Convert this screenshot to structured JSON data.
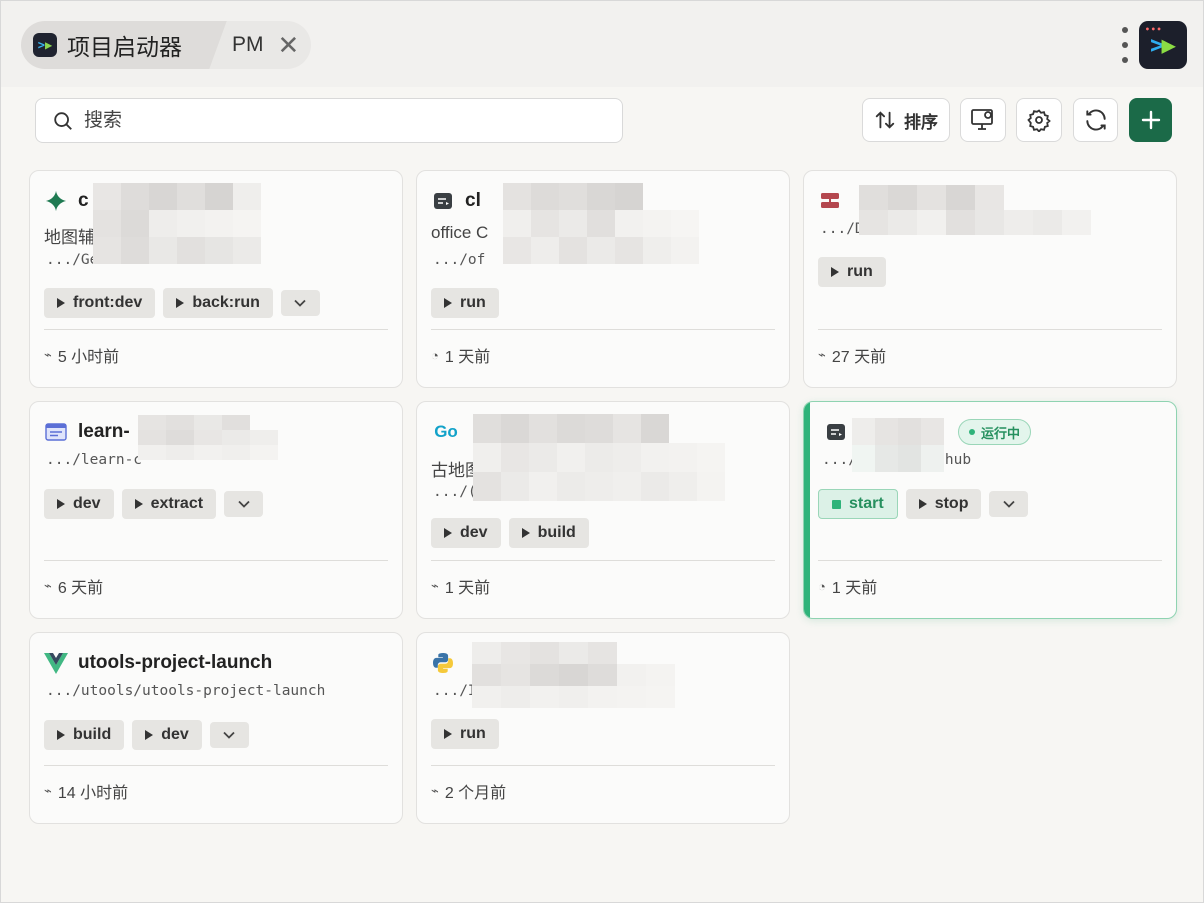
{
  "app": {
    "tab_title": "项目启动器",
    "tab_sub": "PM",
    "close_glyph": "✕"
  },
  "search": {
    "placeholder": "搜索"
  },
  "toolbar": {
    "sort_label": "排序"
  },
  "colors": {
    "accent": "#1b6a48",
    "running": "#2fb37a"
  },
  "projects": [
    {
      "icon": "gemini-sparkle-icon",
      "name": "c",
      "desc": "地图辅",
      "path": ".../Ge",
      "actions": [
        "front:dev",
        "back:run"
      ],
      "has_more": true,
      "time": "5 小时前",
      "time_icon": "⌁"
    },
    {
      "icon": "terminal-app-icon",
      "name": "cl",
      "desc": "office C",
      "path": ".../of",
      "actions": [
        "run"
      ],
      "has_more": false,
      "time": "1 天前",
      "time_icon": "◔"
    },
    {
      "icon": "server-icon",
      "name": "",
      "desc": "",
      "path": ".../D",
      "actions": [
        "run"
      ],
      "has_more": false,
      "time": "27 天前",
      "time_icon": "⌁"
    },
    {
      "icon": "browser-window-icon",
      "name": "learn-",
      "desc": "",
      "path": ".../learn-c",
      "actions": [
        "dev",
        "extract"
      ],
      "has_more": true,
      "time": "6 天前",
      "time_icon": "⌁"
    },
    {
      "icon": "go-lang-icon",
      "name": "",
      "desc": "古地图",
      "path": ".../(",
      "actions": [
        "dev",
        "build"
      ],
      "has_more": false,
      "time": "1 天前",
      "time_icon": "⌁"
    },
    {
      "icon": "terminal-app-icon",
      "name": "",
      "desc": "",
      "path": ".../",
      "path_tail": "hub",
      "badge": "运行中",
      "running_action": "start",
      "actions": [
        "stop"
      ],
      "has_more": true,
      "time": "1 天前",
      "time_icon": "◔"
    },
    {
      "icon": "vue-icon",
      "name": "utools-project-launch",
      "desc": "",
      "path": ".../utools/utools-project-launch",
      "actions": [
        "build",
        "dev"
      ],
      "has_more": true,
      "time": "14 小时前",
      "time_icon": "⌁"
    },
    {
      "icon": "python-icon",
      "name": "",
      "desc": "",
      "path": ".../I",
      "actions": [
        "run"
      ],
      "has_more": false,
      "time": "2 个月前",
      "time_icon": "⌁"
    }
  ]
}
